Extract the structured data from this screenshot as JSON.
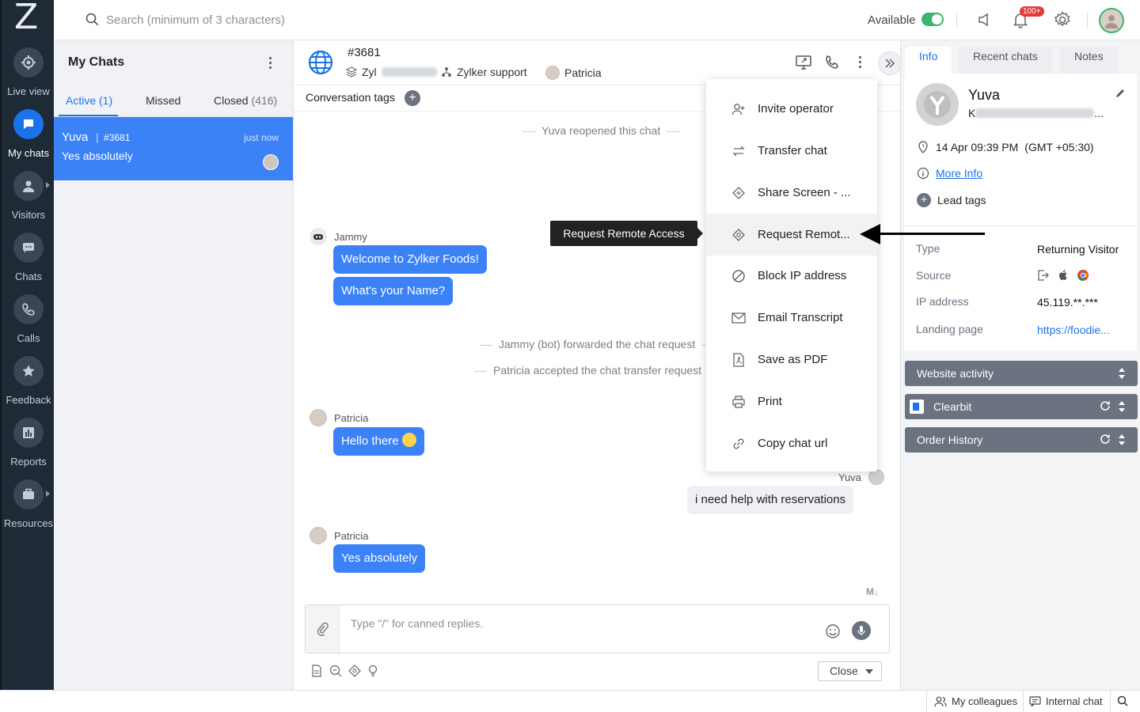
{
  "rail": {
    "logo": "Z",
    "items": [
      {
        "label": "Live view",
        "icon": "crosshair-icon"
      },
      {
        "label": "My chats",
        "icon": "chat-bubble-icon",
        "active": true
      },
      {
        "label": "Visitors",
        "icon": "person-icon"
      },
      {
        "label": "Chats",
        "icon": "chat-dots-icon"
      },
      {
        "label": "Calls",
        "icon": "phone-icon"
      },
      {
        "label": "Feedback",
        "icon": "star-icon"
      },
      {
        "label": "Reports",
        "icon": "bar-chart-icon"
      },
      {
        "label": "Resources",
        "icon": "briefcase-icon"
      }
    ]
  },
  "topbar": {
    "search_placeholder": "Search (minimum of 3 characters)",
    "availability_label": "Available",
    "notification_badge": "100+"
  },
  "chat_list": {
    "title": "My Chats",
    "tabs": [
      {
        "label": "Active",
        "count": "(1)"
      },
      {
        "label": "Missed",
        "count": ""
      },
      {
        "label": "Closed",
        "count": "(416)"
      }
    ],
    "items": [
      {
        "name": "Yuva",
        "separator": "|",
        "id": "#3681",
        "time": "just now",
        "last_message": "Yes absolutely"
      }
    ]
  },
  "conversation": {
    "id": "#3681",
    "company": "Zyl",
    "department": "Zylker support",
    "operator": "Patricia",
    "tags_label": "Conversation tags",
    "messages": {
      "sys_reopened": "Yuva reopened this chat",
      "bot_name": "Jammy",
      "bot_msg_1": "Welcome to Zylker Foods!",
      "bot_msg_2": "What's your Name?",
      "sys_forwarded": "Jammy (bot) forwarded the chat request",
      "sys_accepted": "Patricia accepted the chat transfer request",
      "op_name_1": "Patricia",
      "op_msg_1": "Hello there",
      "visitor_name": "Yuva",
      "visitor_msg": "i need help with reservations",
      "op_name_2": "Patricia",
      "op_msg_2": "Yes absolutely"
    },
    "composer_placeholder": "Type \"/\" for canned replies.",
    "markdown_label": "M↓",
    "close_label": "Close"
  },
  "menu": {
    "items": [
      {
        "label": "Invite operator",
        "icon": "invite-operator-icon"
      },
      {
        "label": "Transfer chat",
        "icon": "transfer-icon"
      },
      {
        "label": "Share Screen - ...",
        "icon": "share-screen-icon"
      },
      {
        "label": "Request Remot...",
        "icon": "remote-access-icon"
      },
      {
        "label": "Block IP address",
        "icon": "block-icon"
      },
      {
        "label": "Email Transcript",
        "icon": "email-icon"
      },
      {
        "label": "Save as PDF",
        "icon": "pdf-icon"
      },
      {
        "label": "Print",
        "icon": "print-icon"
      },
      {
        "label": "Copy chat url",
        "icon": "link-icon"
      }
    ],
    "hovered_index": 3,
    "tooltip": "Request Remote Access"
  },
  "right_panel": {
    "tabs": [
      "Info",
      "Recent chats",
      "Notes"
    ],
    "visitor_name": "Yuva",
    "visitor_email_prefix": "K",
    "visitor_email_suffix": "...",
    "local_time": "14 Apr 09:39 PM",
    "timezone": "(GMT +05:30)",
    "more_info": "More Info",
    "lead_tags": "Lead tags",
    "details": [
      {
        "key": "Type",
        "value": "Returning Visitor"
      },
      {
        "key": "Source",
        "value": ""
      },
      {
        "key": "IP address",
        "value": "45.119.**.***"
      },
      {
        "key": "Landing page",
        "value": "https://foodie..."
      }
    ],
    "sections": [
      "Website activity",
      "Clearbit",
      "Order History"
    ]
  },
  "bottombar": {
    "colleagues": "My colleagues",
    "internal_chat": "Internal chat"
  },
  "colors": {
    "accent": "#1a73e8",
    "bubble": "#3b82f6",
    "rail": "#1f2a37",
    "online": "#3cb371"
  }
}
